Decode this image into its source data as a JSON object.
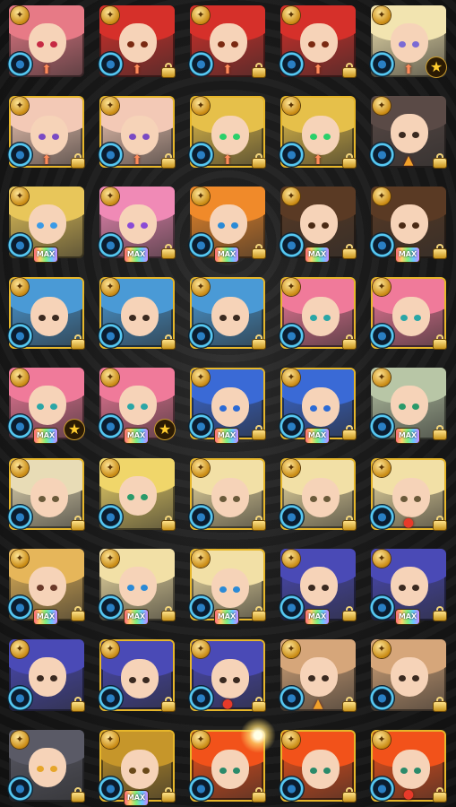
{
  "colors": {
    "gold_frame": "#e6b62a",
    "element_ring": "#56c8f2",
    "water_blue": "#2a7fc4",
    "lock_gold": "#f3d57a",
    "star_gold": "#ffcc2e"
  },
  "icon_names": {
    "top_badge": "rank-medal-icon",
    "element": "water-element-icon",
    "lock": "lock-icon",
    "star": "star-icon",
    "fruit": "fruit-icon",
    "fire": "fire-icon"
  },
  "grid": {
    "rows": 9,
    "columns": 5,
    "cells": [
      {
        "hair": "#e77a86",
        "eye": "#c62a44",
        "frame": "plain",
        "sub": "",
        "mark": "arrows",
        "lock": false,
        "star": false
      },
      {
        "hair": "#d6302a",
        "eye": "#7a2a12",
        "frame": "plain",
        "sub": "",
        "mark": "arrows",
        "lock": true,
        "star": false
      },
      {
        "hair": "#d6302a",
        "eye": "#7a2a12",
        "frame": "plain",
        "sub": "",
        "mark": "arrows",
        "lock": true,
        "star": false
      },
      {
        "hair": "#d6302a",
        "eye": "#7a2a12",
        "frame": "plain",
        "sub": "",
        "mark": "arrows",
        "lock": true,
        "star": false
      },
      {
        "hair": "#f2e4b0",
        "eye": "#7a6ad4",
        "frame": "plain",
        "sub": "",
        "mark": "arrows",
        "lock": false,
        "star": true
      },
      {
        "hair": "#f3c9b6",
        "eye": "#7a4ac4",
        "frame": "gold",
        "sub": "",
        "mark": "arrows",
        "lock": true,
        "star": false
      },
      {
        "hair": "#f3c9b6",
        "eye": "#7a4ac4",
        "frame": "gold",
        "sub": "",
        "mark": "arrows",
        "lock": true,
        "star": false
      },
      {
        "hair": "#e6c04a",
        "eye": "#2ad06a",
        "frame": "gold",
        "sub": "",
        "mark": "arrows",
        "lock": true,
        "star": false
      },
      {
        "hair": "#e6c04a",
        "eye": "#2ad06a",
        "frame": "gold",
        "sub": "",
        "mark": "arrows",
        "lock": true,
        "star": false
      },
      {
        "hair": "#5a4a46",
        "eye": "#3a2a20",
        "frame": "plain",
        "sub": "",
        "mark": "fire",
        "lock": true,
        "star": false
      },
      {
        "hair": "#e8c65a",
        "eye": "#3a9ae6",
        "frame": "plain",
        "sub": "MAX",
        "mark": "",
        "lock": false,
        "star": false
      },
      {
        "hair": "#f08ab6",
        "eye": "#8a4ad6",
        "frame": "plain",
        "sub": "MAX",
        "mark": "",
        "lock": true,
        "star": false
      },
      {
        "hair": "#f08a2a",
        "eye": "#2a8ad6",
        "frame": "plain",
        "sub": "MAX",
        "mark": "",
        "lock": true,
        "star": false
      },
      {
        "hair": "#5a3a24",
        "eye": "#4a2a14",
        "frame": "plain",
        "sub": "MAX",
        "mark": "",
        "lock": true,
        "star": false
      },
      {
        "hair": "#5a3a24",
        "eye": "#4a2a14",
        "frame": "plain",
        "sub": "MAX",
        "mark": "",
        "lock": true,
        "star": false
      },
      {
        "hair": "#4a9ad6",
        "eye": "#3a2a20",
        "frame": "gold",
        "sub": "",
        "mark": "",
        "lock": true,
        "star": false
      },
      {
        "hair": "#4a9ad6",
        "eye": "#3a2a20",
        "frame": "gold",
        "sub": "",
        "mark": "",
        "lock": true,
        "star": false
      },
      {
        "hair": "#4a9ad6",
        "eye": "#3a2a20",
        "frame": "gold",
        "sub": "",
        "mark": "",
        "lock": true,
        "star": false
      },
      {
        "hair": "#f07a9a",
        "eye": "#2aa6a6",
        "frame": "gold",
        "sub": "",
        "mark": "",
        "lock": true,
        "star": false
      },
      {
        "hair": "#f07a9a",
        "eye": "#2aa6a6",
        "frame": "gold",
        "sub": "",
        "mark": "",
        "lock": true,
        "star": false
      },
      {
        "hair": "#f07a9a",
        "eye": "#2aa6a6",
        "frame": "plain",
        "sub": "MAX",
        "mark": "",
        "lock": false,
        "star": true
      },
      {
        "hair": "#f07a9a",
        "eye": "#2aa6a6",
        "frame": "plain",
        "sub": "MAX",
        "mark": "",
        "lock": false,
        "star": true
      },
      {
        "hair": "#3a6ad6",
        "eye": "#2a6ad6",
        "frame": "gold",
        "sub": "MAX",
        "mark": "",
        "lock": true,
        "star": false
      },
      {
        "hair": "#3a6ad6",
        "eye": "#2a6ad6",
        "frame": "gold",
        "sub": "MAX",
        "mark": "",
        "lock": true,
        "star": false
      },
      {
        "hair": "#b8c6a6",
        "eye": "#2a9a6a",
        "frame": "plain",
        "sub": "MAX",
        "mark": "",
        "lock": true,
        "star": false
      },
      {
        "hair": "#e8dcb6",
        "eye": "#6a5a3a",
        "frame": "gold",
        "sub": "",
        "mark": "",
        "lock": true,
        "star": false
      },
      {
        "hair": "#f0d66a",
        "eye": "#2a9a6a",
        "frame": "plain",
        "sub": "",
        "mark": "",
        "lock": true,
        "star": false
      },
      {
        "hair": "#f2e0a6",
        "eye": "#6a5a3a",
        "frame": "gold",
        "sub": "",
        "mark": "",
        "lock": true,
        "star": false
      },
      {
        "hair": "#f2e0a6",
        "eye": "#6a5a3a",
        "frame": "gold",
        "sub": "",
        "mark": "",
        "lock": true,
        "star": false
      },
      {
        "hair": "#f2e0a6",
        "eye": "#6a5a3a",
        "frame": "gold",
        "sub": "",
        "mark": "fruit",
        "lock": true,
        "star": false
      },
      {
        "hair": "#e6b65a",
        "eye": "#6a3a2a",
        "frame": "plain",
        "sub": "MAX",
        "mark": "",
        "lock": true,
        "star": false
      },
      {
        "hair": "#f2e0a6",
        "eye": "#2a8ad6",
        "frame": "plain",
        "sub": "MAX",
        "mark": "fruit",
        "lock": true,
        "star": false
      },
      {
        "hair": "#f2e0a6",
        "eye": "#2a8ad6",
        "frame": "gold",
        "sub": "MAX",
        "mark": "",
        "lock": true,
        "star": false
      },
      {
        "hair": "#4a4ab6",
        "eye": "#3a2a20",
        "frame": "plain",
        "sub": "MAX",
        "mark": "fruit",
        "lock": true,
        "star": false
      },
      {
        "hair": "#4a4ab6",
        "eye": "#3a2a20",
        "frame": "plain",
        "sub": "MAX",
        "mark": "",
        "lock": true,
        "star": false
      },
      {
        "hair": "#4a4ab6",
        "eye": "#3a2a20",
        "frame": "plain",
        "sub": "",
        "mark": "",
        "lock": true,
        "star": false
      },
      {
        "hair": "#4a4ab6",
        "eye": "#3a2a20",
        "frame": "gold",
        "sub": "",
        "mark": "",
        "lock": true,
        "star": false
      },
      {
        "hair": "#4a4ab6",
        "eye": "#3a2a20",
        "frame": "gold",
        "sub": "",
        "mark": "fruit",
        "lock": true,
        "star": false
      },
      {
        "hair": "#d6a67a",
        "eye": "#3a2a20",
        "frame": "plain",
        "sub": "",
        "mark": "fire",
        "lock": true,
        "star": false
      },
      {
        "hair": "#d6a67a",
        "eye": "#3a2a20",
        "frame": "plain",
        "sub": "",
        "mark": "",
        "lock": true,
        "star": false
      },
      {
        "hair": "#5a5a66",
        "eye": "#e6a62a",
        "frame": "plain",
        "sub": "",
        "mark": "",
        "lock": true,
        "star": false
      },
      {
        "hair": "#c6962a",
        "eye": "#6a4a1a",
        "frame": "gold",
        "sub": "MAX",
        "mark": "",
        "lock": true,
        "star": false
      },
      {
        "hair": "#f2521a",
        "eye": "#2a8a6a",
        "frame": "gold",
        "sub": "",
        "mark": "",
        "lock": true,
        "star": false
      },
      {
        "hair": "#f2521a",
        "eye": "#2a8a6a",
        "frame": "gold",
        "sub": "",
        "mark": "",
        "lock": true,
        "star": false
      },
      {
        "hair": "#f2521a",
        "eye": "#2a8a6a",
        "frame": "gold",
        "sub": "",
        "mark": "fruit",
        "lock": true,
        "star": false
      }
    ]
  }
}
